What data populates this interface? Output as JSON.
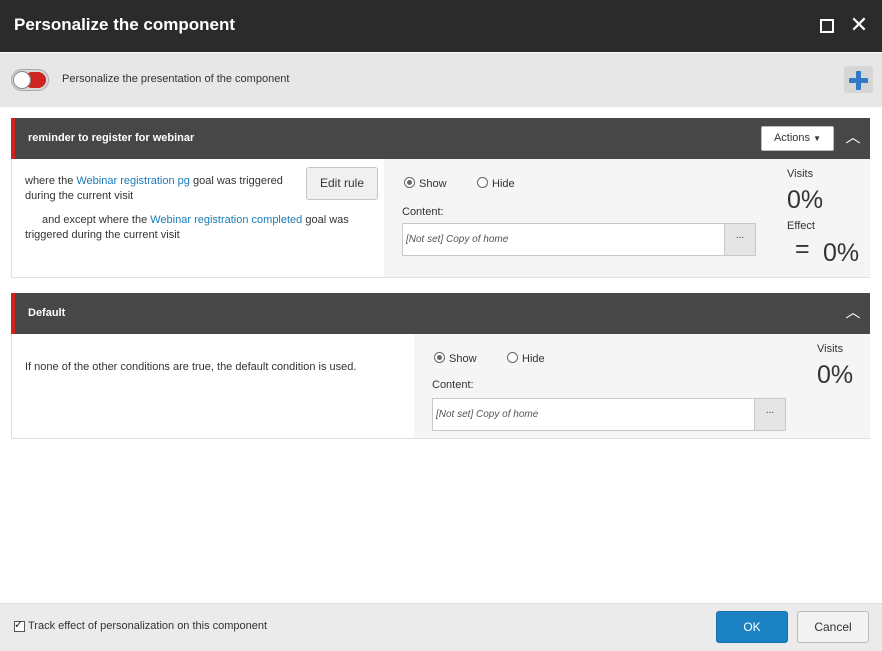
{
  "dialog": {
    "title": "Personalize the component"
  },
  "toggle_bar": {
    "label": "Personalize the presentation of the component"
  },
  "rules": [
    {
      "name": "reminder to register for webinar",
      "actions_label": "Actions",
      "condition": {
        "line1_prefix": "where the ",
        "line1_link": "Webinar registration pg",
        "line1_suffix": " goal was triggered",
        "line2": "during the current visit",
        "line3_prefix": "and except where the ",
        "line3_link": "Webinar registration completed",
        "line3_suffix": " goal was",
        "line4": "triggered during the current visit"
      },
      "edit_rule_label": "Edit rule",
      "show_label": "Show",
      "hide_label": "Hide",
      "selected": "Show",
      "content_label": "Content:",
      "content_value": "[Not set] Copy of home",
      "browse_label": "...",
      "visits_label": "Visits",
      "visits_value": "0%",
      "effect_label": "Effect",
      "effect_symbol": "=",
      "effect_value": "0%"
    },
    {
      "name": "Default",
      "condition_text": "If none of the other conditions are true, the default condition is used.",
      "show_label": "Show",
      "hide_label": "Hide",
      "selected": "Show",
      "content_label": "Content:",
      "content_value": "[Not set] Copy of home",
      "browse_label": "...",
      "visits_label": "Visits",
      "visits_value": "0%"
    }
  ],
  "footer": {
    "track_label": "Track effect of personalization on this component",
    "track_checked": true,
    "ok_label": "OK",
    "cancel_label": "Cancel"
  },
  "colors": {
    "accent_red": "#d0221e",
    "header_dark": "#2b2b2b",
    "rule_header": "#474747",
    "link_blue": "#1a7bb9",
    "ok_blue": "#1b82c4",
    "plus_blue": "#2f79c5"
  }
}
